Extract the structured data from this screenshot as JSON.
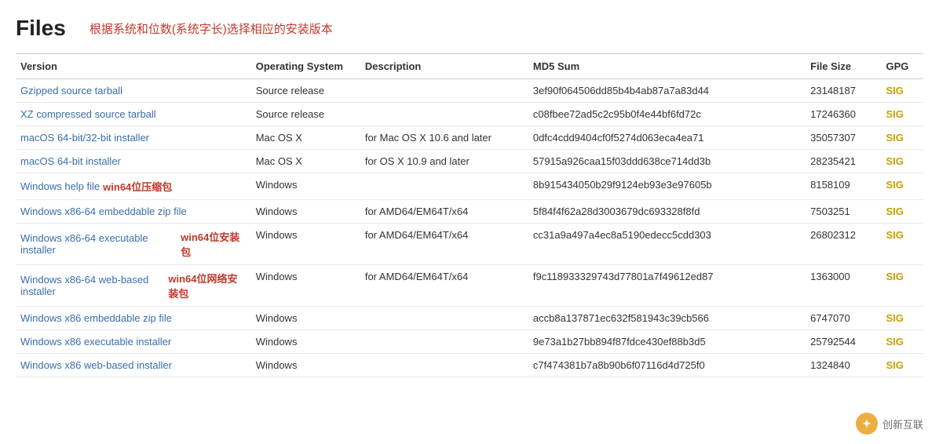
{
  "header": {
    "title": "Files",
    "subtitle": "根据系统和位数(系统字长)选择相应的安装版本"
  },
  "table": {
    "columns": [
      {
        "key": "version",
        "label": "Version"
      },
      {
        "key": "os",
        "label": "Operating System"
      },
      {
        "key": "description",
        "label": "Description"
      },
      {
        "key": "md5",
        "label": "MD5 Sum"
      },
      {
        "key": "filesize",
        "label": "File Size"
      },
      {
        "key": "gpg",
        "label": "GPG"
      }
    ],
    "rows": [
      {
        "version": "Gzipped source tarball",
        "os": "Source release",
        "description": "",
        "md5": "3ef90f064506dd85b4b4ab87a7a83d44",
        "filesize": "23148187",
        "gpg": "SIG",
        "annotation": ""
      },
      {
        "version": "XZ compressed source tarball",
        "os": "Source release",
        "description": "",
        "md5": "c08fbee72ad5c2c95b0f4e44bf6fd72c",
        "filesize": "17246360",
        "gpg": "SIG",
        "annotation": ""
      },
      {
        "version": "macOS 64-bit/32-bit installer",
        "os": "Mac OS X",
        "description": "for Mac OS X 10.6 and later",
        "md5": "0dfc4cdd9404cf0f5274d063eca4ea71",
        "filesize": "35057307",
        "gpg": "SIG",
        "annotation": ""
      },
      {
        "version": "macOS 64-bit installer",
        "os": "Mac OS X",
        "description": "for OS X 10.9 and later",
        "md5": "57915a926caa15f03ddd638ce714dd3b",
        "filesize": "28235421",
        "gpg": "SIG",
        "annotation": ""
      },
      {
        "version": "Windows help file",
        "os": "Windows",
        "description": "",
        "md5": "8b915434050b29f9124eb93e3e97605b",
        "filesize": "8158109",
        "gpg": "SIG",
        "annotation": "win64位压缩包"
      },
      {
        "version": "Windows x86-64 embeddable zip file",
        "os": "Windows",
        "description": "for AMD64/EM64T/x64",
        "md5": "5f84f4f62a28d3003679dc693328f8fd",
        "filesize": "7503251",
        "gpg": "SIG",
        "annotation": ""
      },
      {
        "version": "Windows x86-64 executable installer",
        "os": "Windows",
        "description": "for AMD64/EM64T/x64",
        "md5": "cc31a9a497a4ec8a5190edecc5cdd303",
        "filesize": "26802312",
        "gpg": "SIG",
        "annotation": "win64位安装包"
      },
      {
        "version": "Windows x86-64 web-based installer",
        "os": "Windows",
        "description": "for AMD64/EM64T/x64",
        "md5": "f9c118933329743d77801a7f49612ed87",
        "filesize": "1363000",
        "gpg": "SIG",
        "annotation": "win64位网络安装包"
      },
      {
        "version": "Windows x86 embeddable zip file",
        "os": "Windows",
        "description": "",
        "md5": "accb8a137871ec632f581943c39cb566",
        "filesize": "6747070",
        "gpg": "SIG",
        "annotation": ""
      },
      {
        "version": "Windows x86 executable installer",
        "os": "Windows",
        "description": "",
        "md5": "9e73a1b27bb894f87fdce430ef88b3d5",
        "filesize": "25792544",
        "gpg": "SIG",
        "annotation": ""
      },
      {
        "version": "Windows x86 web-based installer",
        "os": "Windows",
        "description": "",
        "md5": "c7f474381b7a8b90b6f07116d4d725f0",
        "filesize": "1324840",
        "gpg": "SIG",
        "annotation": ""
      }
    ]
  },
  "watermark": {
    "icon": "✦",
    "text": "创新互联"
  }
}
